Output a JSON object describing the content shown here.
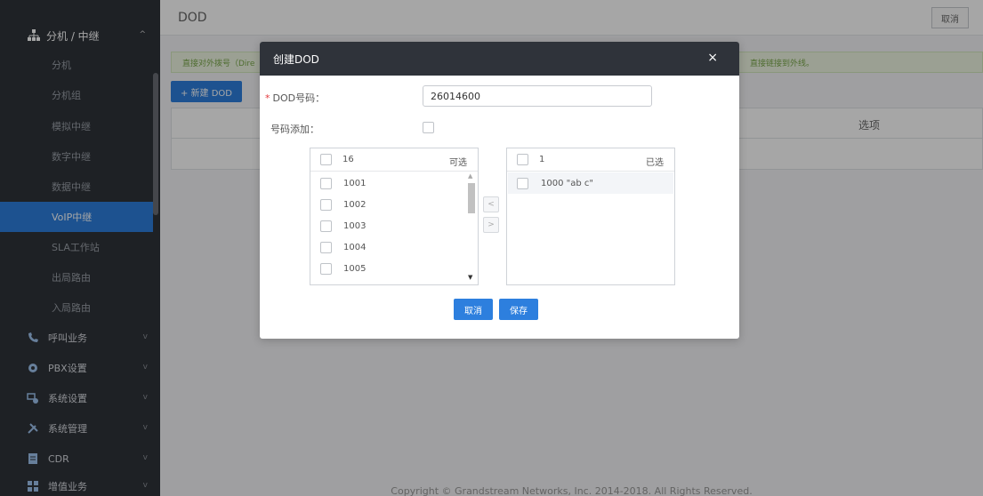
{
  "sidebar": {
    "section": {
      "label": "分机 / 中继",
      "icon": "network-icon"
    },
    "subitems": [
      {
        "label": "分机",
        "active": false
      },
      {
        "label": "分机组",
        "active": false
      },
      {
        "label": "模拟中继",
        "active": false
      },
      {
        "label": "数字中继",
        "active": false
      },
      {
        "label": "数据中继",
        "active": false
      },
      {
        "label": "VoIP中继",
        "active": true
      },
      {
        "label": "SLA工作站",
        "active": false
      },
      {
        "label": "出局路由",
        "active": false
      },
      {
        "label": "入局路由",
        "active": false
      }
    ],
    "groups": [
      {
        "label": "呼叫业务",
        "icon": "phone-icon"
      },
      {
        "label": "PBX设置",
        "icon": "gear-icon"
      },
      {
        "label": "系统设置",
        "icon": "settings-icon"
      },
      {
        "label": "系统管理",
        "icon": "tools-icon"
      },
      {
        "label": "CDR",
        "icon": "document-icon"
      },
      {
        "label": "增值业务",
        "icon": "grid-icon"
      }
    ]
  },
  "main": {
    "title": "DOD",
    "cancel_label": "取消",
    "info_left": "直接对外拨号（Dire",
    "info_right": "直接链接到外线。",
    "new_button": "+ 新建 DOD",
    "col_options": "选项",
    "footer": "Copyright © Grandstream Networks, Inc. 2014-2018. All Rights Reserved."
  },
  "modal": {
    "title": "创建DOD",
    "close": "×",
    "dod_label": "DOD号码：",
    "dod_required": "*",
    "dod_value": "26014600",
    "add_label": "号码添加：",
    "available": {
      "count": "16",
      "title": "可选",
      "items": [
        "1001",
        "1002",
        "1003",
        "1004",
        "1005"
      ]
    },
    "selected": {
      "count": "1",
      "title": "已选",
      "items": [
        "1000 \"ab c\""
      ]
    },
    "move_left": "<",
    "move_right": ">",
    "cancel_label": "取消",
    "save_label": "保存"
  },
  "colors": {
    "accent": "#2d7fde",
    "sidebar_bg": "#2f333a",
    "modal_header": "#2f333a",
    "required": "#e4393c"
  }
}
